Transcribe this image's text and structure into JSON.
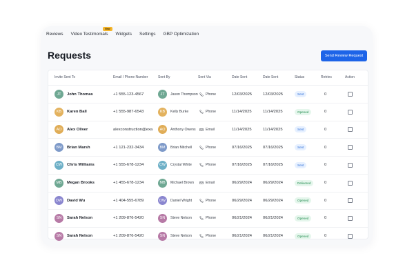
{
  "tabs": [
    {
      "label": "Reviews"
    },
    {
      "label": "Video Testimonials",
      "badge": "New"
    },
    {
      "label": "Widgets"
    },
    {
      "label": "Settings"
    },
    {
      "label": "GBP Optimization"
    }
  ],
  "page_title": "Requests",
  "send_button_label": "Send Review Request",
  "columns": [
    "Invite Sent To",
    "Email / Phone Number",
    "Sent By",
    "Sent Via",
    "Date Sent",
    "Date Sent",
    "Status",
    "Retries",
    "Action"
  ],
  "rows": [
    {
      "initials": "JT",
      "name": "John Thomas",
      "contact": "+1 555-123-4567",
      "by_initials": "JT",
      "by": "Jason Thompson",
      "via": "Phone",
      "via_icon": "phone-icon",
      "date1": "12/03/2025",
      "date2": "12/03/2025",
      "status": "Sent",
      "retries": "0",
      "color": "#6fa893",
      "by_color": "#6fa893"
    },
    {
      "initials": "KB",
      "name": "Karen Ball",
      "contact": "+1 555-987-6543",
      "by_initials": "KB",
      "by": "Kelly Burke",
      "via": "Phone",
      "via_icon": "phone-icon",
      "date1": "11/14/2025",
      "date2": "11/14/2025",
      "status": "Opened",
      "retries": "0",
      "color": "#e3b25e",
      "by_color": "#e3b25e"
    },
    {
      "initials": "AO",
      "name": "Alex Oliver",
      "contact": "alexconstruction@exa",
      "by_initials": "AO",
      "by": "Anthony Owens",
      "via": "Email",
      "via_icon": "mail-icon",
      "date1": "11/14/2025",
      "date2": "11/14/2025",
      "status": "Sent",
      "retries": "0",
      "color": "#e0ad57",
      "by_color": "#e0ad57"
    },
    {
      "initials": "BM",
      "name": "Brian Marsh",
      "contact": "+1 121-232-3434",
      "by_initials": "BM",
      "by": "Brian Mitchell",
      "via": "Phone",
      "via_icon": "phone-icon",
      "date1": "07/16/2025",
      "date2": "07/16/2025",
      "status": "Sent",
      "retries": "0",
      "color": "#7e9ac9",
      "by_color": "#7e9ac9"
    },
    {
      "initials": "CW",
      "name": "Chris Williams",
      "contact": "+1 555-678-1234",
      "by_initials": "CW",
      "by": "Crystal White",
      "via": "Phone",
      "via_icon": "phone-icon",
      "date1": "07/16/2025",
      "date2": "07/16/2025",
      "status": "Sent",
      "retries": "0",
      "color": "#6eb0c7",
      "by_color": "#6eb0c7"
    },
    {
      "initials": "MB",
      "name": "Megan Brooks",
      "contact": "+1 455-678-1234",
      "by_initials": "MB",
      "by": "Michael Brown",
      "via": "Email",
      "via_icon": "mail-icon",
      "date1": "06/29/2024",
      "date2": "06/29/2024",
      "status": "Delivered",
      "retries": "0",
      "color": "#6fa893",
      "by_color": "#6fa893"
    },
    {
      "initials": "DW",
      "name": "David Wu",
      "contact": "+1 404-555-6789",
      "by_initials": "DW",
      "by": "Daniel Wright",
      "via": "Phone",
      "via_icon": "phone-icon",
      "date1": "06/29/2024",
      "date2": "06/29/2024",
      "status": "Opened",
      "retries": "0",
      "color": "#8a86cf",
      "by_color": "#8a86cf"
    },
    {
      "initials": "SN",
      "name": "Sarah Nelson",
      "contact": "+1 209-876-5420",
      "by_initials": "SN",
      "by": "Steve Nelson",
      "via": "Phone",
      "via_icon": "phone-icon",
      "date1": "06/21/2024",
      "date2": "06/21/2024",
      "status": "Opened",
      "retries": "0",
      "color": "#b77aa6",
      "by_color": "#b77aa6"
    },
    {
      "initials": "SN",
      "name": "Sarah Nelson",
      "contact": "+1 209-876-5420",
      "by_initials": "SN",
      "by": "Steve Nelson",
      "via": "Phone",
      "via_icon": "phone-icon",
      "date1": "06/21/2024",
      "date2": "06/21/2024",
      "status": "Opened",
      "retries": "0",
      "color": "#b77aa6",
      "by_color": "#b77aa6"
    }
  ],
  "colors": {
    "accent": "#1d64e8",
    "badge": "#f5b52a",
    "sent": "#2f6fd8",
    "opened": "#1e8a4c"
  }
}
